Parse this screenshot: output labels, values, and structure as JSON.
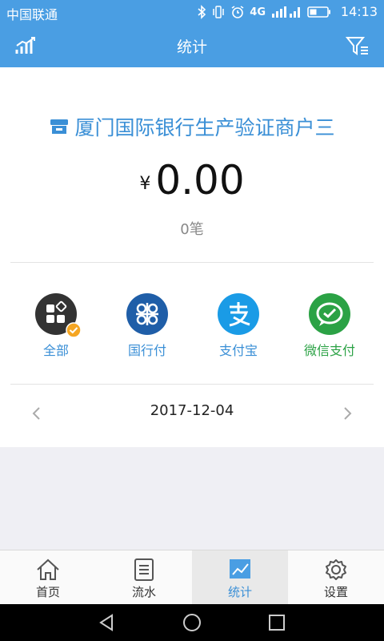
{
  "status_bar": {
    "carrier": "中国联通",
    "time": "14:13",
    "network": "4G"
  },
  "header": {
    "title": "统计"
  },
  "merchant": {
    "name": "厦门国际银行生产验证商户三"
  },
  "summary": {
    "currency": "¥",
    "amount": "0.00",
    "count": "0笔"
  },
  "payment_methods": [
    {
      "label": "全部",
      "color": "#333333"
    },
    {
      "label": "国行付",
      "color": "#1f5ea8"
    },
    {
      "label": "支付宝",
      "color": "#1a9be6"
    },
    {
      "label": "微信支付",
      "color": "#2ba245"
    }
  ],
  "date_nav": {
    "date": "2017-12-04"
  },
  "tabs": [
    {
      "label": "首页"
    },
    {
      "label": "流水"
    },
    {
      "label": "统计"
    },
    {
      "label": "设置"
    }
  ],
  "colors": {
    "primary": "#4a9ee3",
    "accent": "#3a8fd6",
    "badge": "#f5a623"
  }
}
